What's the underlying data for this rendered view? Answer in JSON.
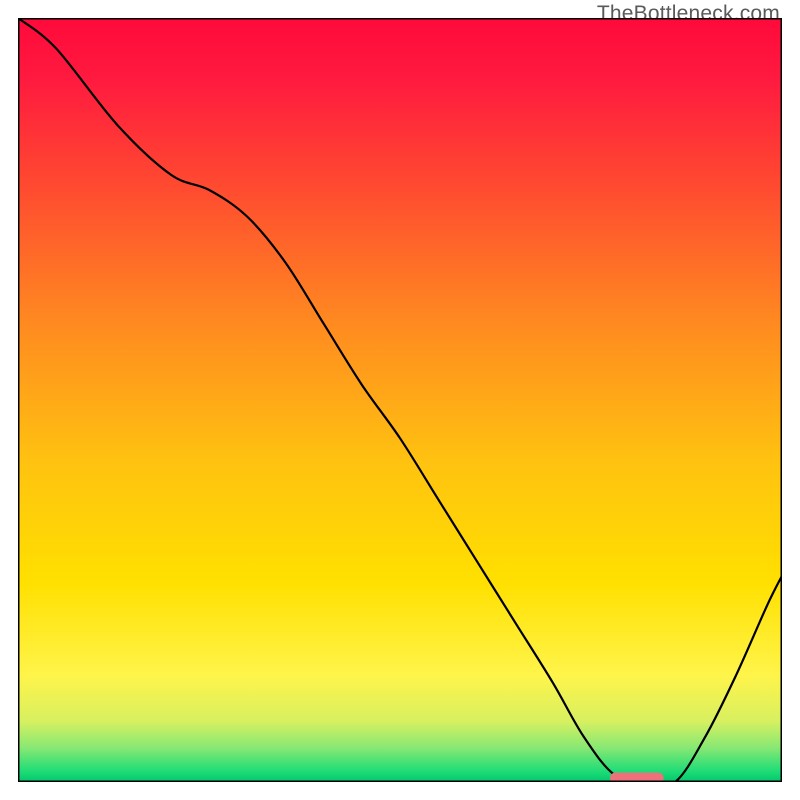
{
  "watermark": "TheBottleneck.com",
  "chart_data": {
    "type": "line",
    "title": "",
    "xlabel": "",
    "ylabel": "",
    "xlim": [
      0,
      100
    ],
    "ylim": [
      0,
      100
    ],
    "grid": false,
    "legend": false,
    "gradient_stops": [
      {
        "offset": 0,
        "color": "#ff0a3b"
      },
      {
        "offset": 0.08,
        "color": "#ff1a3f"
      },
      {
        "offset": 0.22,
        "color": "#ff4a30"
      },
      {
        "offset": 0.4,
        "color": "#ff8a20"
      },
      {
        "offset": 0.58,
        "color": "#ffc210"
      },
      {
        "offset": 0.74,
        "color": "#ffe000"
      },
      {
        "offset": 0.86,
        "color": "#fff44a"
      },
      {
        "offset": 0.92,
        "color": "#d8f060"
      },
      {
        "offset": 0.955,
        "color": "#88e873"
      },
      {
        "offset": 0.985,
        "color": "#22dd77"
      },
      {
        "offset": 1.0,
        "color": "#00c86e"
      }
    ],
    "curve": {
      "x": [
        0,
        5,
        13,
        20,
        25,
        30,
        35,
        40,
        45,
        50,
        55,
        60,
        65,
        70,
        74,
        78,
        82,
        86,
        90,
        94,
        98,
        100
      ],
      "y": [
        100,
        96,
        86,
        79.5,
        77.5,
        74,
        68,
        60,
        52,
        45,
        37,
        29,
        21,
        13,
        6,
        1,
        0,
        0,
        6,
        14,
        23,
        27
      ]
    },
    "marker": {
      "x_start": 77.5,
      "x_end": 84.5,
      "y": 0.5,
      "color": "#ee707b"
    },
    "frame_color": "#000000",
    "curve_color": "#000000",
    "curve_width": 2.2
  }
}
